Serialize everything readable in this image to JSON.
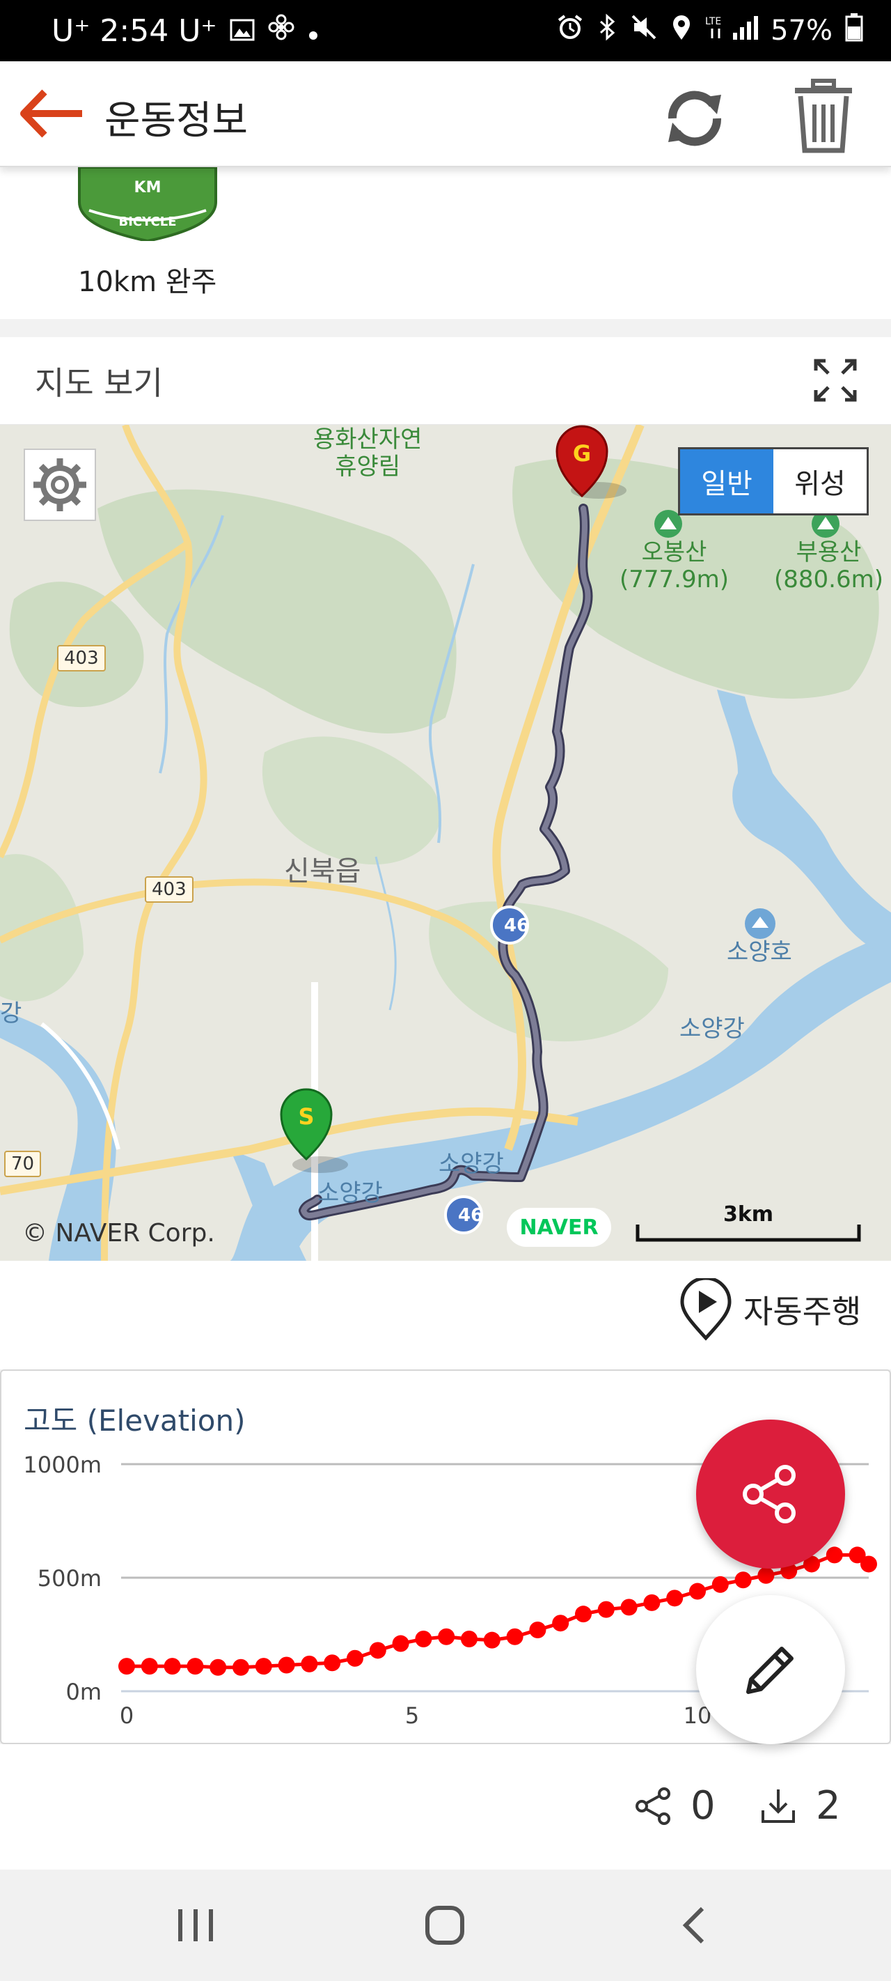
{
  "status_bar": {
    "left_text": "U⁺ 2:54 U⁺",
    "battery": "57%"
  },
  "header": {
    "title": "운동정보"
  },
  "badge": {
    "label": "10km 완주",
    "emblem_text": "KM",
    "ribbon_text": "BICYCLE"
  },
  "map": {
    "section_title": "지도 보기",
    "map_type": {
      "normal": "일반",
      "satellite": "위성",
      "selected": "일반"
    },
    "labels": {
      "rest_area": "용화산자연\n휴양림",
      "obongsan": "오봉산\n(777.9m)",
      "buyongsan": "부용산\n(880.6m)",
      "town": "신북읍",
      "lake": "소양호",
      "river1": "소양강",
      "river2": "소양강",
      "river3": "소양강",
      "river_left": "강"
    },
    "road_shields": [
      "403",
      "403",
      "46",
      "46",
      "70"
    ],
    "start_marker": "S",
    "goal_marker": "G",
    "copyright": "© NAVER Corp.",
    "logo": "NAVER",
    "scale": "3km",
    "colors": {
      "route": "#6f6f86",
      "water": "#a6cde9",
      "road": "#f7d98a",
      "forest": "#c9d9bd"
    }
  },
  "autoplay": {
    "label": "자동주행"
  },
  "elevation": {
    "title": "고도 (Elevation)"
  },
  "chart_data": {
    "type": "line",
    "title": "고도 (Elevation)",
    "xlabel": "",
    "ylabel": "",
    "x_ticks": [
      "0",
      "5",
      "10"
    ],
    "y_ticks": [
      "1000m",
      "500m",
      "0m"
    ],
    "xlim": [
      0,
      13
    ],
    "ylim": [
      0,
      1000
    ],
    "grid": true,
    "series": [
      {
        "color": "#ff0000",
        "x": [
          0,
          0.4,
          0.8,
          1.2,
          1.6,
          2.0,
          2.4,
          2.8,
          3.2,
          3.6,
          4.0,
          4.4,
          4.8,
          5.2,
          5.6,
          6.0,
          6.4,
          6.8,
          7.2,
          7.6,
          8.0,
          8.4,
          8.8,
          9.2,
          9.6,
          10.0,
          10.4,
          10.8,
          11.2,
          11.6,
          12.0,
          12.4,
          12.8,
          13.0
        ],
        "values": [
          110,
          110,
          110,
          110,
          105,
          105,
          110,
          115,
          120,
          125,
          145,
          180,
          210,
          230,
          240,
          230,
          225,
          240,
          270,
          300,
          340,
          360,
          370,
          390,
          410,
          440,
          470,
          490,
          510,
          530,
          560,
          600,
          600,
          560
        ]
      }
    ]
  },
  "counts": {
    "shares": "0",
    "downloads": "2"
  }
}
